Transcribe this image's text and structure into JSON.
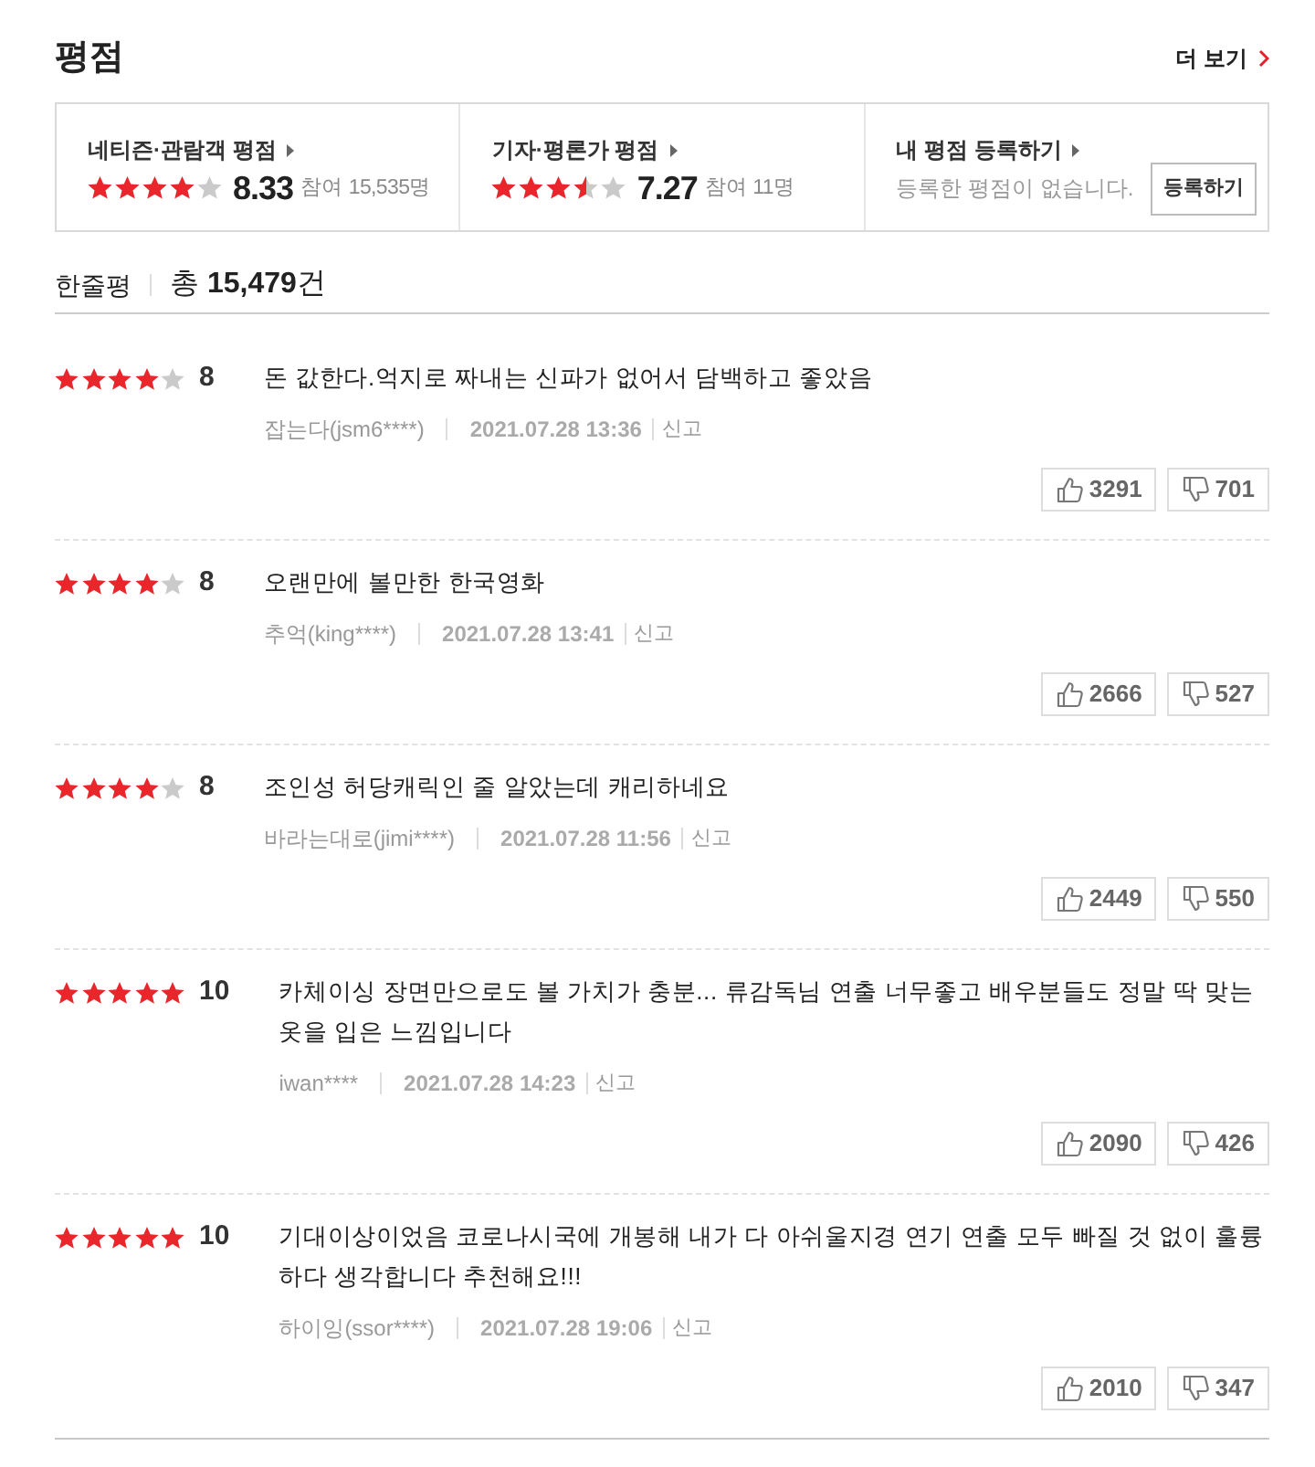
{
  "header": {
    "title": "평점",
    "more": "더 보기"
  },
  "summary": [
    {
      "kind": "rating",
      "label": "네티즌·관람객 평점",
      "stars": 4,
      "score": "8.33",
      "participation": "참여 15,535명"
    },
    {
      "kind": "rating",
      "label": "기자·평론가 평점",
      "stars": 3.5,
      "score": "7.27",
      "participation": "참여 11명"
    },
    {
      "kind": "register",
      "label": "내 평점 등록하기",
      "message": "등록한 평점이 없습니다.",
      "button": "등록하기"
    }
  ],
  "reviews_header": {
    "title": "한줄평",
    "total": "총 **15,479**건"
  },
  "reviews": [
    {
      "stars": 4,
      "score": "8",
      "text": "돈 값한다.억지로 짜내는 신파가 없어서 담백하고 좋았음",
      "author": "잡는다(jsm6****)",
      "date": "2021.07.28 13:36",
      "report": "신고",
      "likes": "3291",
      "dislikes": "701"
    },
    {
      "stars": 4,
      "score": "8",
      "text": "오랜만에 볼만한 한국영화",
      "author": "추억(king****)",
      "date": "2021.07.28 13:41",
      "report": "신고",
      "likes": "2666",
      "dislikes": "527"
    },
    {
      "stars": 4,
      "score": "8",
      "text": "조인성 허당캐릭인 줄 알았는데 캐리하네요",
      "author": "바라는대로(jimi****)",
      "date": "2021.07.28 11:56",
      "report": "신고",
      "likes": "2449",
      "dislikes": "550"
    },
    {
      "stars": 5,
      "score": "10",
      "text": "카체이싱 장면만으로도 볼 가치가 충분... 류감독님 연출 너무좋고 배우분들도 정말 딱 맞는 옷을 입은 느낌입니다",
      "author": "iwan****",
      "date": "2021.07.28 14:23",
      "report": "신고",
      "likes": "2090",
      "dislikes": "426"
    },
    {
      "stars": 5,
      "score": "10",
      "text": "기대이상이었음 코로나시국에 개봉해 내가 다 아쉬울지경 연기 연출 모두 빠질 것 없이 훌륭하다 생각합니다 추천해요!!!",
      "author": "하이잉(ssor****)",
      "date": "2021.07.28 19:06",
      "report": "신고",
      "likes": "2010",
      "dislikes": "347"
    }
  ]
}
